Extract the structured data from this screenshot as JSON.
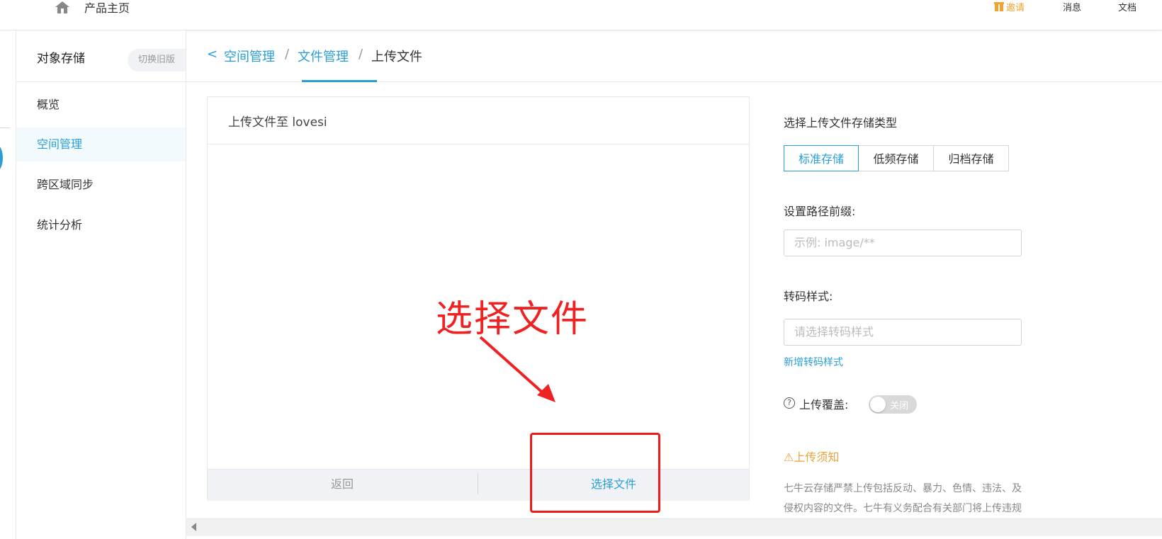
{
  "topbar": {
    "title": "产品主页",
    "invite": "邀请",
    "messages": "消息",
    "docs": "文档"
  },
  "sidebar": {
    "title": "对象存储",
    "switch_old": "切换旧版",
    "items": [
      {
        "label": "概览"
      },
      {
        "label": "空间管理",
        "active": true
      },
      {
        "label": "跨区域同步"
      },
      {
        "label": "统计分析"
      }
    ]
  },
  "breadcrumb": {
    "back": "<",
    "items": [
      "空间管理",
      "文件管理",
      "上传文件"
    ],
    "separator": "/"
  },
  "upload_panel": {
    "title": "上传文件至 lovesi",
    "back_button": "返回",
    "select_button": "选择文件"
  },
  "annotation": {
    "text": "选择文件",
    "color": "#ee2222"
  },
  "settings": {
    "storage_type_label": "选择上传文件存储类型",
    "storage_types": [
      "标准存储",
      "低频存储",
      "归档存储"
    ],
    "storage_type_selected": "标准存储",
    "prefix_label": "设置路径前缀:",
    "prefix_placeholder": "示例: image/**",
    "transcode_label": "转码样式:",
    "transcode_placeholder": "请选择转码样式",
    "add_transcode_link": "新增转码样式",
    "overwrite_label": "上传覆盖:",
    "overwrite_state": "关闭",
    "notice_title": "⚠上传须知",
    "notice_text": "七牛云存储严禁上传包括反动、暴力、色情、违法、及侵权内容的文件。七牛有义务配合有关部门将上传违规"
  },
  "colors": {
    "accent": "#2a9fd6",
    "warning": "#e8a33c",
    "annotation": "#ee2222"
  }
}
